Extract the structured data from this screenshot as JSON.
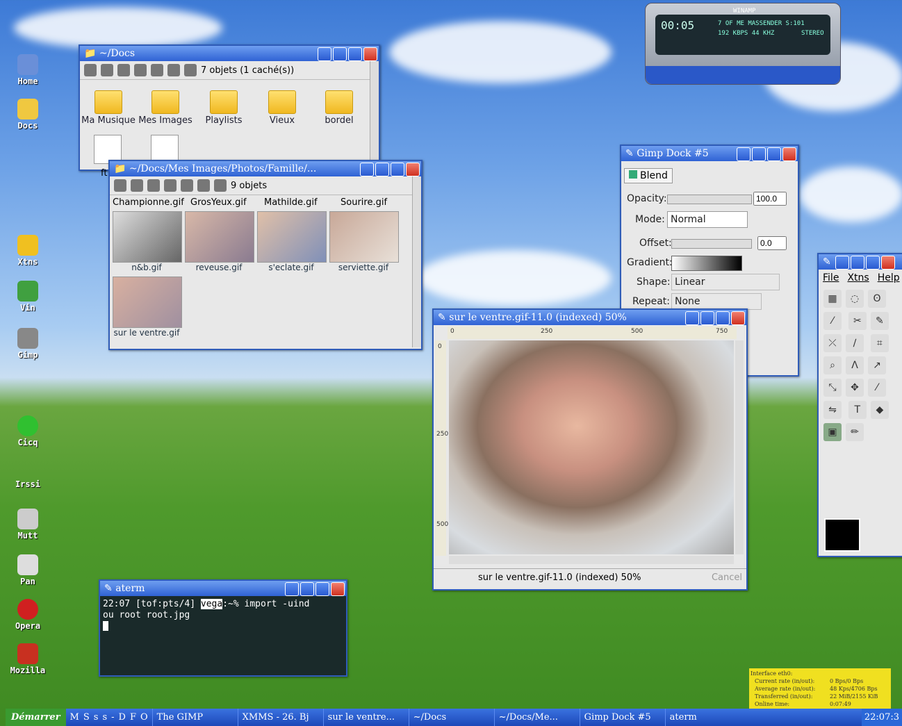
{
  "desktop_icons": [
    {
      "label": "Home"
    },
    {
      "label": "Docs"
    },
    {
      "label": "Xtns"
    },
    {
      "label": "Vin"
    },
    {
      "label": "Gimp"
    },
    {
      "label": "Cicq"
    },
    {
      "label": "Irssi"
    },
    {
      "label": "Mutt"
    },
    {
      "label": "Pan"
    },
    {
      "label": "Opera"
    },
    {
      "label": "Mozilla"
    }
  ],
  "xmms": {
    "time": "00:05",
    "info": "7 OF ME  MASSENDER  S:101",
    "bitrate": "192 KBPS  44 KHZ",
    "stereo": "STEREO",
    "name": "WINAMP"
  },
  "docs_window": {
    "title": "~/Docs",
    "status": "7 objets (1 caché(s))",
    "items": [
      "Ma Musique",
      "Mes Images",
      "Playlists",
      "Vieux",
      "bordel"
    ],
    "partial": "ft"
  },
  "photos_window": {
    "title": "~/Docs/Mes Images/Photos/Famille/...",
    "status": "9 objets",
    "row1": [
      "Championne.gif",
      "GrosYeux.gif",
      "Mathilde.gif",
      "Sourire.gif"
    ],
    "row2": [
      "n&b.gif",
      "reveuse.gif",
      "s'eclate.gif",
      "serviette.gif"
    ],
    "row3": [
      "sur le ventre.gif"
    ]
  },
  "gimp_dock": {
    "title": "Gimp Dock #5",
    "tool": "Blend",
    "opacity_label": "Opacity:",
    "opacity": "100.0",
    "mode_label": "Mode:",
    "mode": "Normal",
    "offset_label": "Offset:",
    "offset": "0.0",
    "gradient_label": "Gradient:",
    "shape_label": "Shape:",
    "shape": "Linear",
    "repeat_label": "Repeat:",
    "repeat": "None"
  },
  "toolbox": {
    "menu": [
      "File",
      "Xtns",
      "Help"
    ],
    "tools": [
      "T"
    ]
  },
  "image_window": {
    "title": "sur le ventre.gif-11.0 (indexed) 50%",
    "ruler": [
      "0",
      "250",
      "500",
      "750"
    ],
    "vruler": [
      "0",
      "250",
      "500"
    ],
    "status": "sur le ventre.gif-11.0 (indexed) 50%",
    "cancel": "Cancel"
  },
  "aterm": {
    "title": "aterm",
    "line1_prefix": "22:07 [tof:pts/4] ",
    "host": "vega",
    "line1_suffix": ":~% import -uind",
    "line2": "ou root root.jpg"
  },
  "netstat": {
    "title": "Interface eth0:",
    "rows": [
      [
        "Current rate (in/out):",
        "0 Bps/0 Bps"
      ],
      [
        "Average rate (in/out):",
        "48 Kps/4706 Bps"
      ],
      [
        "Transferred (in/out):",
        "22 MiB/2155 KiB"
      ],
      [
        "Online time:",
        "0:07:49"
      ]
    ]
  },
  "taskbar": {
    "start": "Démarrer",
    "quick": [
      "M",
      "S",
      "s",
      "s",
      "-",
      "D",
      "F",
      "O"
    ],
    "tasks": [
      "The GIMP",
      "XMMS - 26. Bj",
      "sur le ventre...",
      "~/Docs",
      "~/Docs/Me...",
      "Gimp Dock #5",
      "aterm"
    ],
    "clock": "22:07:3"
  }
}
